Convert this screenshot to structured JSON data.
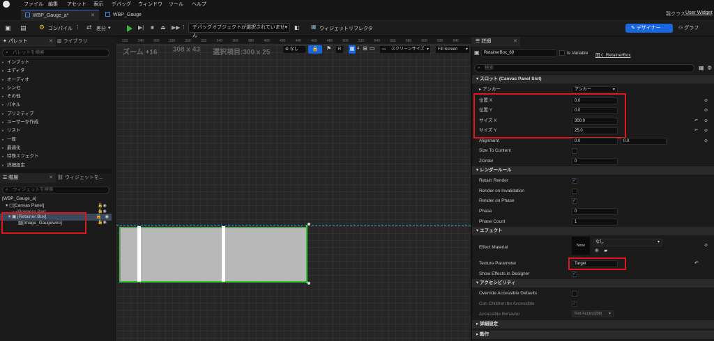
{
  "menu": {
    "file": "ファイル",
    "edit": "編集",
    "asset": "アセット",
    "view": "表示",
    "debug": "デバッグ",
    "window": "ウィンドウ",
    "tools": "ツール",
    "help": "ヘルプ"
  },
  "parent_class": {
    "label": "親クラス",
    "value": "User Widget"
  },
  "tabs": [
    {
      "label": "WBP_Gauge_a*"
    },
    {
      "label": "WBP_Gauge"
    }
  ],
  "toolbar": {
    "compile": "コンパイル",
    "diff": "差分",
    "debug_object": "デバッグオブジェクトが選択されていません",
    "widget_reflector": "ウィジェットリフレクタ",
    "designer": "デザイナー",
    "graph": "グラフ"
  },
  "palette": {
    "tab_label": "パレット",
    "library_label": "ライブラリ",
    "search_placeholder": "パレットを検索",
    "categories": [
      "インプット",
      "エディタ",
      "オーディオ",
      "シンセ",
      "その他",
      "パネル",
      "プリミティブ",
      "ユーザーが作成",
      "リスト",
      "一般",
      "最適化",
      "特殊エフェクト",
      "詳細設定"
    ]
  },
  "hierarchy": {
    "tab_label": "階層",
    "bind_tab_label": "ウィジェットを...",
    "search_placeholder": "ウィジェットを検索",
    "items": [
      "[WBP_Gauge_a]",
      "[Canvas Panel]",
      "[Progress Bar]",
      "[Retainer Box]",
      "[Image_Gaugewire]"
    ]
  },
  "canvas": {
    "zoom": "ズーム +16",
    "size": "308 x 43",
    "selection": "選択項目:300 x 25",
    "toggle_none": "なし",
    "r_label": "R",
    "grid_value": "4",
    "screen_size": "スクリーンサイズ",
    "fill_screen": "Fill Screen",
    "ruler_top": [
      "220",
      "240",
      "260",
      "280",
      "300",
      "320",
      "340",
      "360",
      "380",
      "400",
      "420",
      "440",
      "460",
      "480",
      "500",
      "520",
      "540",
      "560",
      "580",
      "600",
      "620",
      "640"
    ]
  },
  "details": {
    "tab_label": "詳細",
    "widget_name": "RetainerBox_69",
    "is_variable": "Is Variable",
    "open_link": "開く RetainerBox",
    "search_placeholder": "検索",
    "slot_section": "スロット (Canvas Panel Slot)",
    "anchor_label": "アンカー",
    "anchor_value": "アンカー",
    "pos_x_label": "位置 X",
    "pos_x": "0.0",
    "pos_y_label": "位置 Y",
    "pos_y": "0.0",
    "size_x_label": "サイズ X",
    "size_x": "300.0",
    "size_y_label": "サイズ Y",
    "size_y": "25.0",
    "alignment_label": "Alignment",
    "alignment_x": "0.0",
    "alignment_y": "0.0",
    "size_to_content": "Size To Content",
    "zorder_label": "ZOrder",
    "zorder": "0",
    "render_section": "レンダールール",
    "retain_render": "Retain Render",
    "render_on_invalidation": "Render on Invalidation",
    "render_on_phase": "Render on Phase",
    "phase_label": "Phase",
    "phase": "0",
    "phase_count_label": "Phase Count",
    "phase_count": "1",
    "effects_section": "エフェクト",
    "effect_material": "Effect Material",
    "material_none": "None",
    "material_dropdown": "なし",
    "texture_param_label": "Texture Parameter",
    "texture_param": "Target",
    "show_effects": "Show Effects in Designer",
    "accessibility_section": "アクセシビリティ",
    "override_accessible": "Override Accessible Defaults",
    "children_accessible": "Can Children be Accessible",
    "accessible_behavior": "Accessible Behavior",
    "accessible_behavior_value": "Not Accessible",
    "advanced_section": "詳細設定",
    "behavior_section": "動作"
  },
  "colors": {
    "accent": "#1866e0",
    "highlight_box": "#e0161e",
    "play": "#3fb13f",
    "selection_green": "#2ec72e",
    "guide_cyan": "#2bb0e8"
  }
}
